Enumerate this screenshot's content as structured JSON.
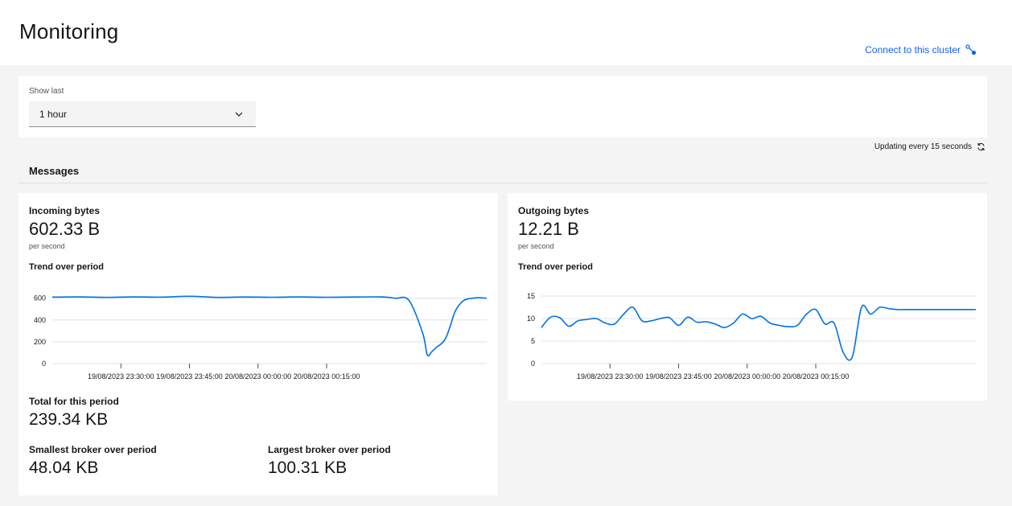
{
  "header": {
    "title": "Monitoring",
    "connect_label": "Connect to this cluster"
  },
  "filter": {
    "label": "Show last",
    "selected": "1 hour"
  },
  "status": {
    "updating": "Updating every 15 seconds"
  },
  "section": {
    "title": "Messages"
  },
  "incoming": {
    "title": "Incoming bytes",
    "value": "602.33 B",
    "unit": "per second",
    "trend_label": "Trend over period",
    "total_label": "Total for this period",
    "total_value": "239.34 KB",
    "smallest_label": "Smallest broker over period",
    "smallest_value": "48.04 KB",
    "largest_label": "Largest broker over period",
    "largest_value": "100.31 KB"
  },
  "outgoing": {
    "title": "Outgoing bytes",
    "value": "12.21 B",
    "unit": "per second",
    "trend_label": "Trend over period"
  },
  "colors": {
    "accent": "#0f62fe",
    "line": "#0072e6",
    "grid": "#e0e0e0"
  },
  "chart_data": [
    {
      "type": "line",
      "name": "incoming",
      "ylim": [
        0,
        620
      ],
      "yticks": [
        0,
        200,
        400,
        600
      ],
      "xticks": [
        "19/08/2023 23:30:00",
        "19/08/2023 23:45:00",
        "20/08/2023 00:00:00",
        "20/08/2023 00:15:00"
      ],
      "x_minutes": [
        0,
        6,
        12,
        18,
        24,
        30,
        36,
        42,
        48,
        54,
        60,
        66,
        72,
        75,
        78,
        81,
        82,
        83,
        84,
        85,
        86,
        87,
        88,
        89,
        90,
        91,
        92,
        93,
        94,
        95
      ],
      "tick_minutes": [
        15,
        30,
        45,
        60
      ],
      "values": [
        610,
        612,
        608,
        612,
        610,
        618,
        608,
        611,
        609,
        612,
        609,
        611,
        612,
        600,
        580,
        280,
        80,
        110,
        150,
        180,
        230,
        340,
        470,
        540,
        580,
        595,
        600,
        605,
        603,
        600
      ]
    },
    {
      "type": "line",
      "name": "outgoing",
      "ylim": [
        0,
        15
      ],
      "yticks": [
        0,
        5,
        10,
        15
      ],
      "xticks": [
        "19/08/2023 23:30:00",
        "19/08/2023 23:45:00",
        "20/08/2023 00:00:00",
        "20/08/2023 00:15:00"
      ],
      "x_minutes": [
        0,
        2,
        4,
        6,
        8,
        10,
        12,
        14,
        16,
        18,
        20,
        22,
        24,
        26,
        28,
        30,
        32,
        34,
        36,
        38,
        40,
        42,
        44,
        46,
        48,
        50,
        52,
        54,
        56,
        58,
        60,
        62,
        64,
        66,
        68,
        70,
        72,
        74,
        76,
        78,
        80,
        82,
        84,
        86,
        88,
        90,
        92,
        94,
        95
      ],
      "tick_minutes": [
        15,
        30,
        45,
        60
      ],
      "values": [
        8,
        10.3,
        10.2,
        8.3,
        9.5,
        9.8,
        10,
        9,
        8.8,
        11,
        12.5,
        9.5,
        9.5,
        10,
        10.2,
        8.5,
        10.3,
        9.2,
        9.3,
        8.8,
        8,
        9,
        11,
        10,
        10.5,
        9,
        8.5,
        8.2,
        8.5,
        11,
        12,
        8.8,
        9,
        2.5,
        1.5,
        12.5,
        11,
        12.5,
        12.2,
        12,
        12,
        12,
        12,
        12,
        12,
        12,
        12,
        12,
        12
      ]
    }
  ]
}
